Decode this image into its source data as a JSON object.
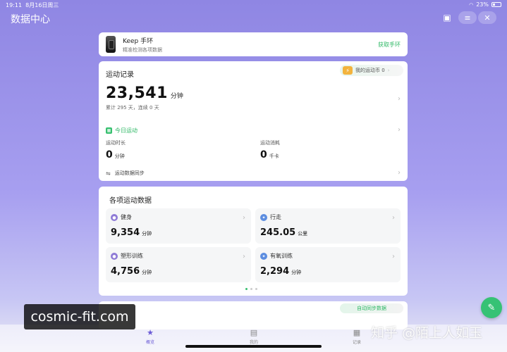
{
  "status_bar": {
    "time": "19:11",
    "date": "8月16日周三",
    "battery": "23%"
  },
  "header": {
    "title": "数据中心"
  },
  "keep_banner": {
    "title": "Keep 手环",
    "subtitle": "精准检测各项数据",
    "action": "获取手环"
  },
  "record": {
    "title": "运动记录",
    "coin_label": "我的运动币 0",
    "total_value": "23,541",
    "total_unit": "分钟",
    "cumulative": "累计 295 天，连续 0 天",
    "today_label": "今日运动",
    "duration_label": "运动时长",
    "duration_value": "0",
    "duration_unit": "分钟",
    "calories_label": "运动消耗",
    "calories_value": "0",
    "calories_unit": "千卡",
    "sync_label": "运动数据同步"
  },
  "sports": {
    "title": "各项运动数据",
    "tiles": [
      {
        "label": "健身",
        "value": "9,354",
        "unit": "分钟"
      },
      {
        "label": "行走",
        "value": "245.05",
        "unit": "公里"
      },
      {
        "label": "塑形训练",
        "value": "4,756",
        "unit": "分钟"
      },
      {
        "label": "有氧训练",
        "value": "2,294",
        "unit": "分钟"
      }
    ]
  },
  "partial_card": {
    "pill": "自动同步数据"
  },
  "tabs": [
    {
      "label": "概览",
      "icon": "star-icon"
    },
    {
      "label": "我的",
      "icon": "note-icon"
    },
    {
      "label": "记录",
      "icon": "grid-icon"
    }
  ],
  "watermarks": {
    "site": "cosmic-fit.com",
    "zhihu": "知乎 @陌上人如玉"
  },
  "colors": {
    "accent": "#36c275",
    "brand_purple": "#8f86e3"
  }
}
